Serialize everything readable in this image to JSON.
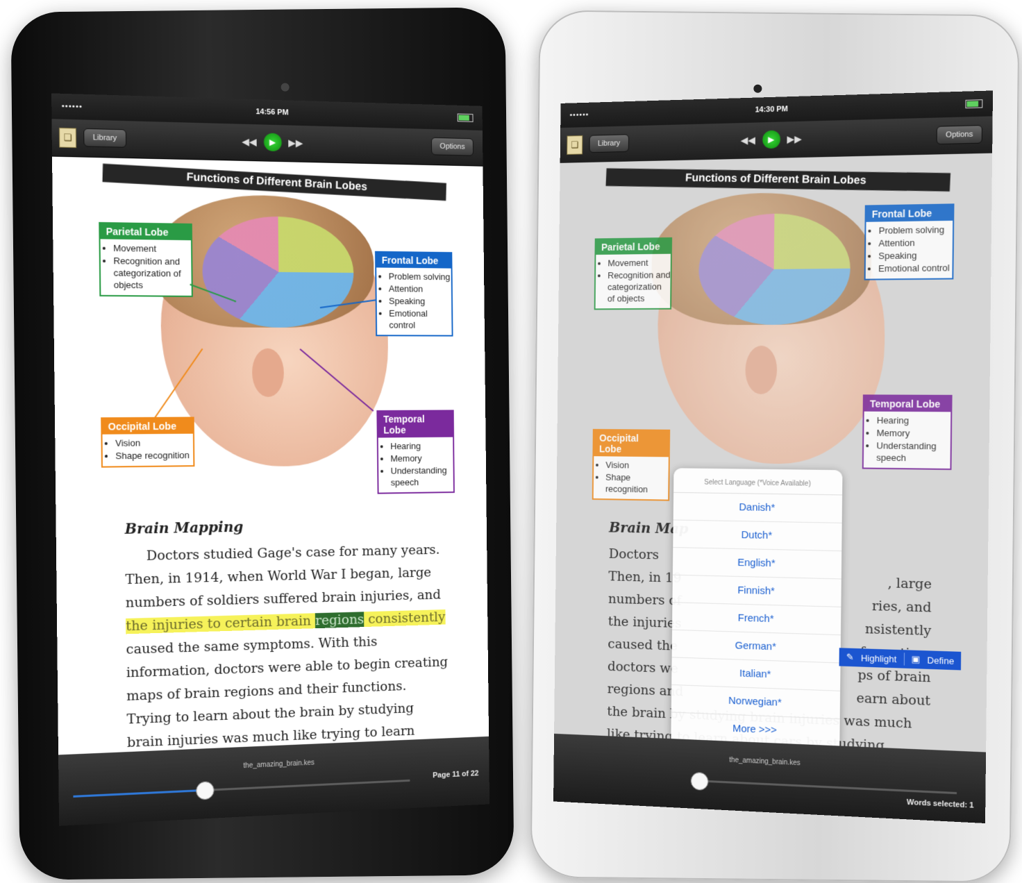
{
  "left_device": {
    "status": {
      "carrier": "••••••",
      "time": "14:56 PM"
    },
    "toolbar": {
      "library_label": "Library",
      "options_label": "Options"
    },
    "figure": {
      "title": "Functions of Different Brain Lobes",
      "parietal": {
        "heading": "Parietal Lobe",
        "items": [
          "Movement",
          "Recognition and categorization of objects"
        ]
      },
      "frontal": {
        "heading": "Frontal Lobe",
        "items": [
          "Problem solving",
          "Attention",
          "Speaking",
          "Emotional control"
        ]
      },
      "occipital": {
        "heading": "Occipital Lobe",
        "items": [
          "Vision",
          "Shape recognition"
        ]
      },
      "temporal": {
        "heading": "Temporal Lobe",
        "items": [
          "Hearing",
          "Memory",
          "Understanding speech"
        ]
      }
    },
    "reading": {
      "heading": "Brain Mapping",
      "p_start": "Doctors studied Gage's case for many years. Then, in 1914, when World War I began, large numbers of soldiers suffered brain injuries, and ",
      "hl_1": "the injuries to certain brain ",
      "hl_strong": "regions",
      "hl_2": " consistently",
      "p_end": " caused the same symptoms. With this information, doctors were able to begin creating maps of brain regions and their functions. Trying to learn about the brain by studying brain injuries was much like trying to learn about cars by studying broken"
    },
    "bottom": {
      "filename": "the_amazing_brain.kes",
      "page_label": "Page 11 of 22",
      "progress": 0.38
    }
  },
  "right_device": {
    "status": {
      "carrier": "••••••",
      "time": "14:30 PM"
    },
    "toolbar": {
      "library_label": "Library",
      "options_label": "Options"
    },
    "figure": {
      "title": "Functions of Different Brain Lobes",
      "parietal": {
        "heading": "Parietal Lobe",
        "items": [
          "Movement",
          "Recognition and categorization of objects"
        ]
      },
      "frontal": {
        "heading": "Frontal Lobe",
        "items": [
          "Problem solving",
          "Attention",
          "Speaking",
          "Emotional control"
        ]
      },
      "occipital": {
        "heading": "Occipital Lobe",
        "items": [
          "Vision",
          "Shape recognition"
        ]
      },
      "temporal": {
        "heading": "Temporal Lobe",
        "items": [
          "Hearing",
          "Memory",
          "Understanding speech"
        ]
      }
    },
    "reading": {
      "heading": "Brain Map",
      "lines": [
        "Doctors",
        "Then, in 19",
        "numbers of",
        "the injuries",
        "caused the",
        "doctors we",
        "regions and"
      ],
      "lines_right": [
        "",
        ", large",
        "ries, and",
        "nsistently",
        "nformation,",
        "ps of brain",
        "earn about"
      ],
      "line_end_1": "the brain by studying brain injuries was much",
      "line_end_2": "like trying to learn about cars by studying broken"
    },
    "popover": {
      "title": "Select Language (*Voice Available)",
      "languages": [
        "Danish*",
        "Dutch*",
        "English*",
        "Finnish*",
        "French*",
        "German*",
        "Italian*",
        "Norwegian*",
        "More >>>"
      ]
    },
    "selection_bar": {
      "highlight": "Highlight",
      "define": "Define"
    },
    "bottom": {
      "filename": "the_amazing_brain.kes",
      "words_selected": "Words selected: 1",
      "progress": 0.02
    }
  }
}
